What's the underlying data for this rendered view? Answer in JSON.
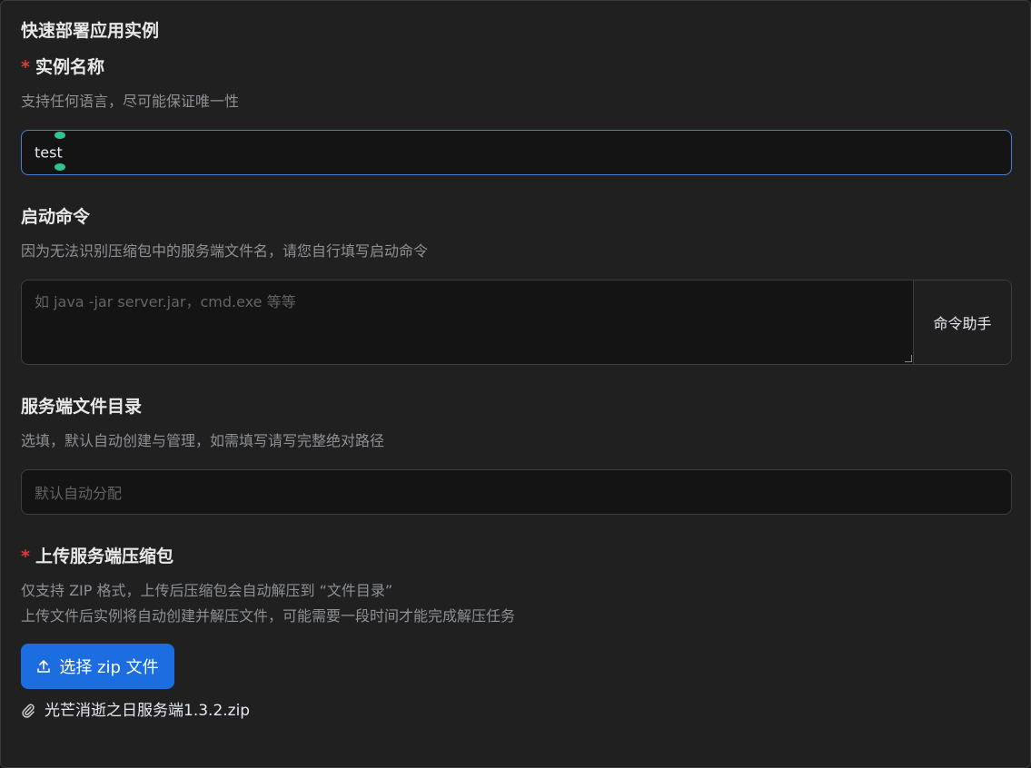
{
  "form": {
    "title": "快速部署应用实例",
    "instance_name": {
      "required_mark": "*",
      "label": "实例名称",
      "description": "支持任何语言，尽可能保证唯一性",
      "value": "test"
    },
    "start_command": {
      "label": "启动命令",
      "description": "因为无法识别压缩包中的服务端文件名，请您自行填写启动命令",
      "placeholder": "如 java -jar server.jar，cmd.exe 等等",
      "helper_button": "命令助手"
    },
    "file_directory": {
      "label": "服务端文件目录",
      "description": "选填，默认自动创建与管理，如需填写请写完整绝对路径",
      "placeholder": "默认自动分配"
    },
    "upload": {
      "required_mark": "*",
      "label": "上传服务端压缩包",
      "description_line1": "仅支持 ZIP 格式，上传后压缩包会自动解压到 “文件目录”",
      "description_line2": "上传文件后实例将自动创建并解压文件，可能需要一段时间才能完成解压任务",
      "button_label": "选择 zip 文件",
      "button_icon": "upload-icon",
      "file_icon": "paperclip-icon",
      "file_name": "光芒消逝之日服务端1.3.2.zip"
    }
  },
  "colors": {
    "background": "#202020",
    "input_background": "#141414",
    "accent": "#1c6ee0",
    "focus_border": "#4b7fd6",
    "required": "#e23b3b"
  }
}
